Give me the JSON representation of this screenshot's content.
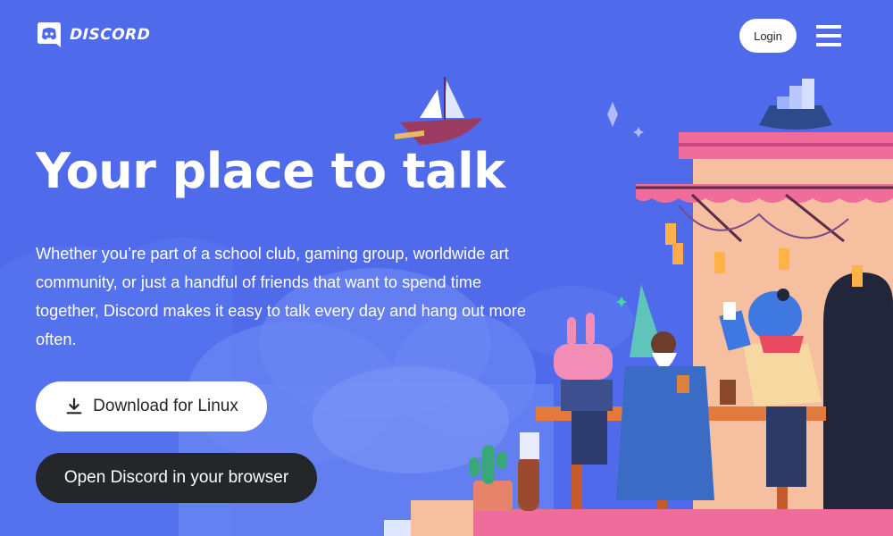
{
  "header": {
    "brand": "DISCORD",
    "login_label": "Login"
  },
  "hero": {
    "title": "Your place to talk",
    "description": "Whether you’re part of a school club, gaming group, worldwide art community, or just a handful of friends that want to spend time together, Discord makes it easy to talk every day and hang out more often.",
    "download_label": "Download for Linux",
    "browser_label": "Open Discord in your browser"
  },
  "icons": {
    "logo": "discord-logo-icon",
    "menu": "hamburger-menu-icon",
    "download": "download-icon"
  },
  "colors": {
    "background": "#4f6aeb",
    "button_light": "#ffffff",
    "button_dark": "#23272a",
    "text": "#ffffff"
  }
}
